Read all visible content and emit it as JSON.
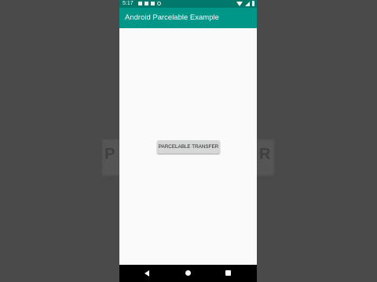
{
  "status_bar": {
    "time": "5:17"
  },
  "app_bar": {
    "title": "Android Parcelable Example"
  },
  "main": {
    "transfer_button_label": "PARCELABLE TRANSFER"
  },
  "background": {
    "left_text": "P",
    "right_text": "R"
  },
  "colors": {
    "primary": "#009688",
    "primary_dark": "#00796b",
    "button": "#d6d7d7",
    "surface": "#fafafa"
  },
  "icons": {
    "status_left": [
      "image-icon",
      "image-icon",
      "document-icon",
      "sync-icon"
    ],
    "status_right": [
      "wifi-icon",
      "signal-icon",
      "battery-icon"
    ],
    "nav": [
      "back-icon",
      "home-icon",
      "recents-icon"
    ]
  }
}
